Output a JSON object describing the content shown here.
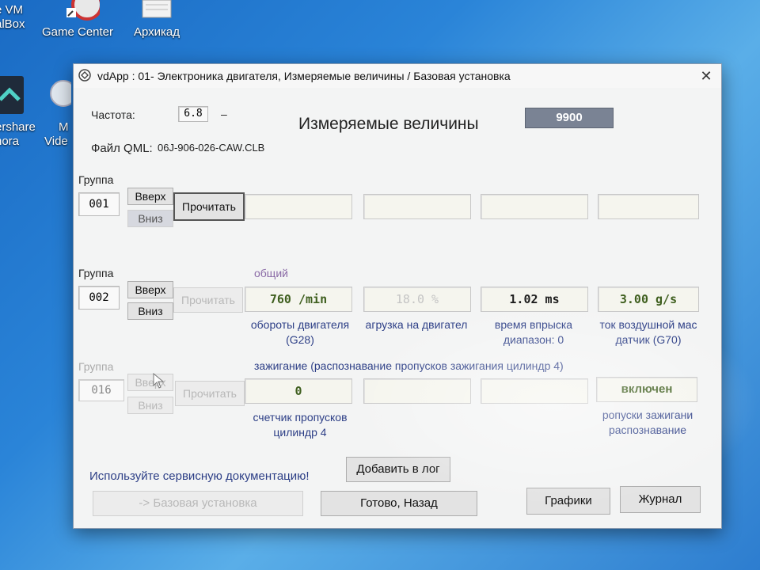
{
  "desktop": {
    "icons": [
      {
        "label_line1": "e VM",
        "label_line2": "alBox"
      },
      {
        "label_line1": "Game Center",
        "label_line2": ""
      },
      {
        "label_line1": "Архикад",
        "label_line2": ""
      },
      {
        "label_line1": "ershare",
        "label_line2": "nora"
      },
      {
        "label_line1": "M",
        "label_line2": "Vide"
      }
    ]
  },
  "window": {
    "title": "vdApp : 01- Электроника двигателя,  Измеряемые величины / Базовая установка",
    "close_glyph": "✕"
  },
  "header": {
    "freq_label": "Частота:",
    "freq_value": "6.8",
    "freq_dash": "–",
    "heading": "Измеряемые величины",
    "counter_value": "9900",
    "qml_label": "Файл QML:",
    "qml_value": "06J-906-026-CAW.CLB"
  },
  "groups": [
    {
      "label": "Группа",
      "number": "001",
      "up_label": "Вверх",
      "down_label": "Вниз",
      "read_label": "Прочитать",
      "title": "",
      "values": [
        "",
        "",
        "",
        ""
      ],
      "captions": [
        "",
        "",
        "",
        ""
      ]
    },
    {
      "label": "Группа",
      "number": "002",
      "up_label": "Вверх",
      "down_label": "Вниз",
      "read_label": "Прочитать",
      "title": "общий",
      "values": [
        "760 /min",
        "18.0 %",
        "1.02 ms",
        "3.00 g/s"
      ],
      "captions": [
        "обороты двигателя\n(G28)",
        "агрузка на двигател",
        "время впрыска\nдиапазон: 0",
        "ток воздушной мас\nдатчик (G70)"
      ]
    },
    {
      "label": "Группа",
      "number": "016",
      "up_label": "Вверх",
      "down_label": "Вниз",
      "read_label": "Прочитать",
      "title": "зажигание (распознавание пропусков зажигания цилиндр 4)",
      "values": [
        "0",
        "",
        "",
        "включен"
      ],
      "captions": [
        "счетчик пропусков\nцилиндр 4",
        "",
        "",
        "ропуски зажигани\nраспознавание"
      ]
    }
  ],
  "footer": {
    "service_note": "Используйте сервисную документацию!",
    "add_log_label": "Добавить в лог",
    "basic_setting_label": "-> Базовая установка",
    "done_back_label": "Готово, Назад",
    "graphs_label": "Графики",
    "journal_label": "Журнал"
  },
  "colors": {
    "value_green": "#3f5f1f",
    "value_dark": "#1e1e1e",
    "value_disabled": "#c4c4c4",
    "caption_blue": "#2c3e86",
    "title_purple": "#8a6aa6",
    "counter_bg": "#7a8394"
  }
}
